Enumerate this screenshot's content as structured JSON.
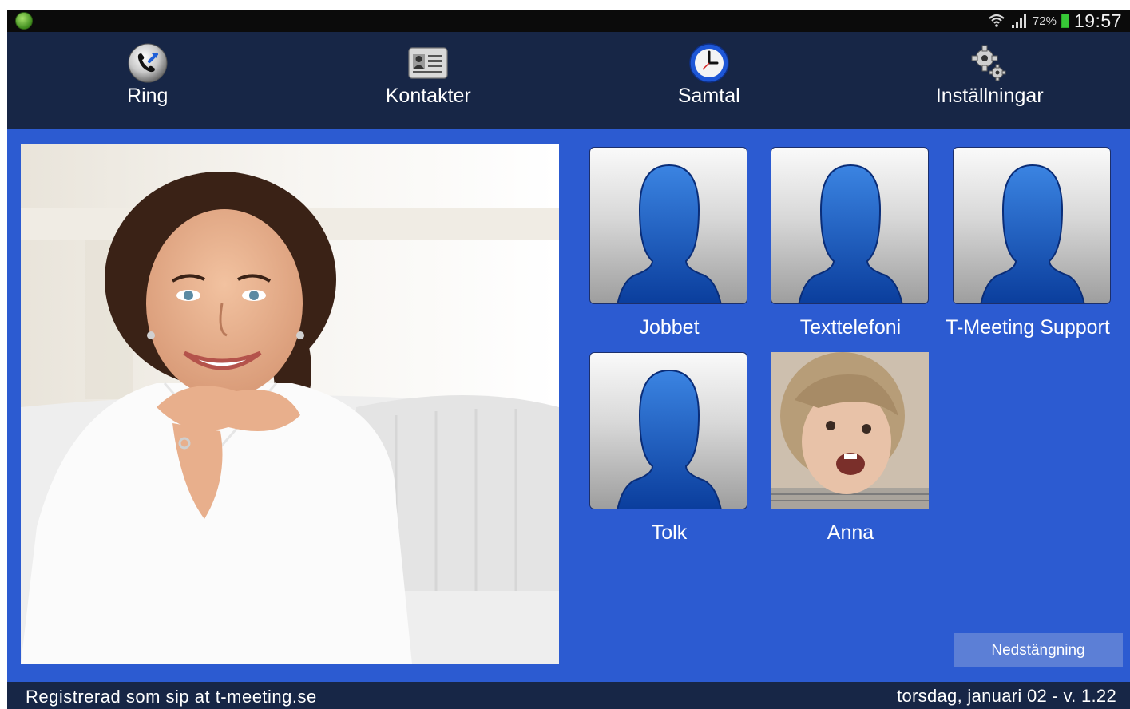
{
  "status_bar": {
    "battery_percent": "72%",
    "time": "19:57",
    "icons": [
      "app-logo",
      "wifi-icon",
      "signal-icon",
      "battery-icon"
    ],
    "battery_level": 0.72
  },
  "nav": {
    "items": [
      {
        "label": "Ring",
        "icon": "phone-icon"
      },
      {
        "label": "Kontakter",
        "icon": "contact-card-icon"
      },
      {
        "label": "Samtal",
        "icon": "clock-icon"
      },
      {
        "label": "Inställningar",
        "icon": "gears-icon"
      }
    ]
  },
  "contacts": [
    {
      "name": "Jobbet",
      "avatar": "default-silhouette"
    },
    {
      "name": "Texttelefoni",
      "avatar": "default-silhouette"
    },
    {
      "name": "T-Meeting Support",
      "avatar": "default-silhouette"
    },
    {
      "name": "Tolk",
      "avatar": "default-silhouette"
    },
    {
      "name": "Anna",
      "avatar": "photo"
    }
  ],
  "shutdown": {
    "label": "Nedstängning"
  },
  "footer": {
    "registration": "Registrerad som sip at t-meeting.se",
    "date_version": "torsdag, januari 02 - v. 1.22"
  },
  "colors": {
    "background_blue": "#2c5bd1",
    "nav_dark": "#172646",
    "status_black": "#0b0b0b",
    "button_blue": "#5c7fd6",
    "battery_green": "#37c837"
  }
}
